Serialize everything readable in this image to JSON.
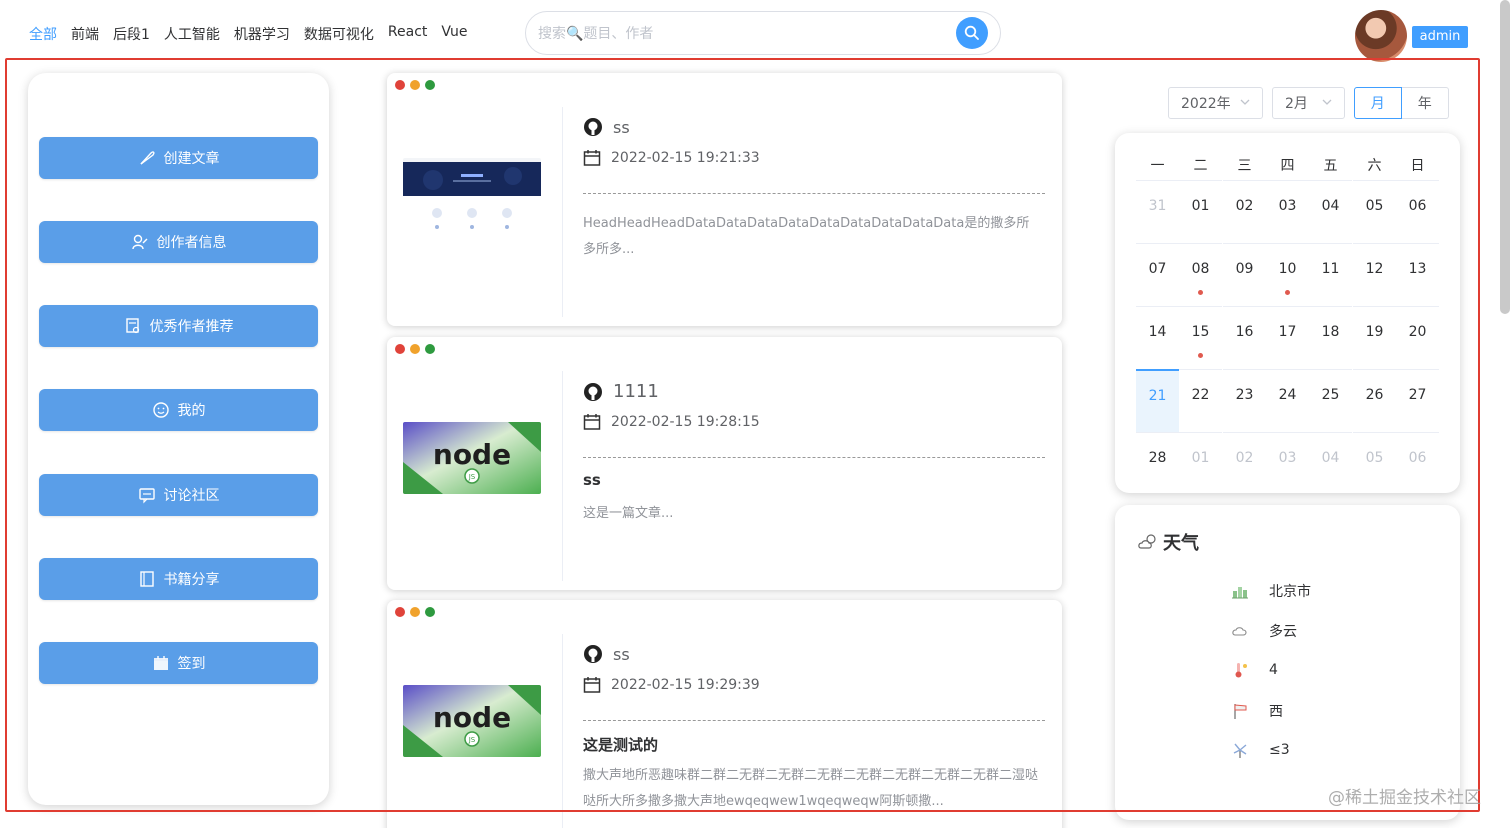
{
  "nav": {
    "categories": [
      "全部",
      "前端",
      "后段1",
      "人工智能",
      "机器学习",
      "数据可视化",
      "React",
      "Vue"
    ],
    "search_placeholder": "搜索🔍题目、作者",
    "user": "admin"
  },
  "menu": [
    {
      "label": "创建文章",
      "icon": "feather-icon"
    },
    {
      "label": "创作者信息",
      "icon": "edit-user-icon"
    },
    {
      "label": "优秀作者推荐",
      "icon": "certificate-icon"
    },
    {
      "label": "我的",
      "icon": "smile-icon"
    },
    {
      "label": "讨论社区",
      "icon": "chat-icon"
    },
    {
      "label": "书籍分享",
      "icon": "book-icon"
    },
    {
      "label": "签到",
      "icon": "calendar-checkin-icon"
    }
  ],
  "articles": [
    {
      "title": "ss",
      "date": "2022-02-15 19:21:33",
      "summary_title": "",
      "summary": "HeadHeadHeadDataDataDataDataDataDataDataDataData是的撒多所多所多...",
      "thumb": "website-screenshot"
    },
    {
      "title": "1111",
      "date": "2022-02-15 19:28:15",
      "summary_title": "ss",
      "summary": "这是一篇文章...",
      "thumb": "nodejs-logo"
    },
    {
      "title": "ss",
      "date": "2022-02-15 19:29:39",
      "summary_title": "这是测试的",
      "summary": "撒大声地所恶趣味群二群二无群二无群二无群二无群二无群二无群二无群二湿哒哒所大所多撒多撒大声地ewqeqwew1wqeqweqw阿斯顿撒...",
      "thumb": "nodejs-logo"
    }
  ],
  "calendar": {
    "year": "2022年",
    "month": "2月",
    "mode_month": "月",
    "mode_year": "年",
    "weekdays": [
      "一",
      "二",
      "三",
      "四",
      "五",
      "六",
      "日"
    ],
    "weeks": [
      [
        "31",
        "01",
        "02",
        "03",
        "04",
        "05",
        "06"
      ],
      [
        "07",
        "08",
        "09",
        "10",
        "11",
        "12",
        "13"
      ],
      [
        "14",
        "15",
        "16",
        "17",
        "18",
        "19",
        "20"
      ],
      [
        "21",
        "22",
        "23",
        "24",
        "25",
        "26",
        "27"
      ],
      [
        "28",
        "01",
        "02",
        "03",
        "04",
        "05",
        "06"
      ]
    ],
    "today": "21",
    "marked_days": [
      "08",
      "10",
      "15"
    ]
  },
  "weather": {
    "title": "天气",
    "city": "北京市",
    "condition": "多云",
    "temperature": "4",
    "wind_direction": "西",
    "wind_power": "≤3"
  },
  "watermark": "@稀土掘金技术社区",
  "colors": {
    "accent": "#409eff",
    "menu_button": "#5a9ee8",
    "frame": "#e03c31",
    "dot_red": "#e0433a",
    "dot_yellow": "#f0a22c",
    "dot_green": "#2e9a3f"
  }
}
